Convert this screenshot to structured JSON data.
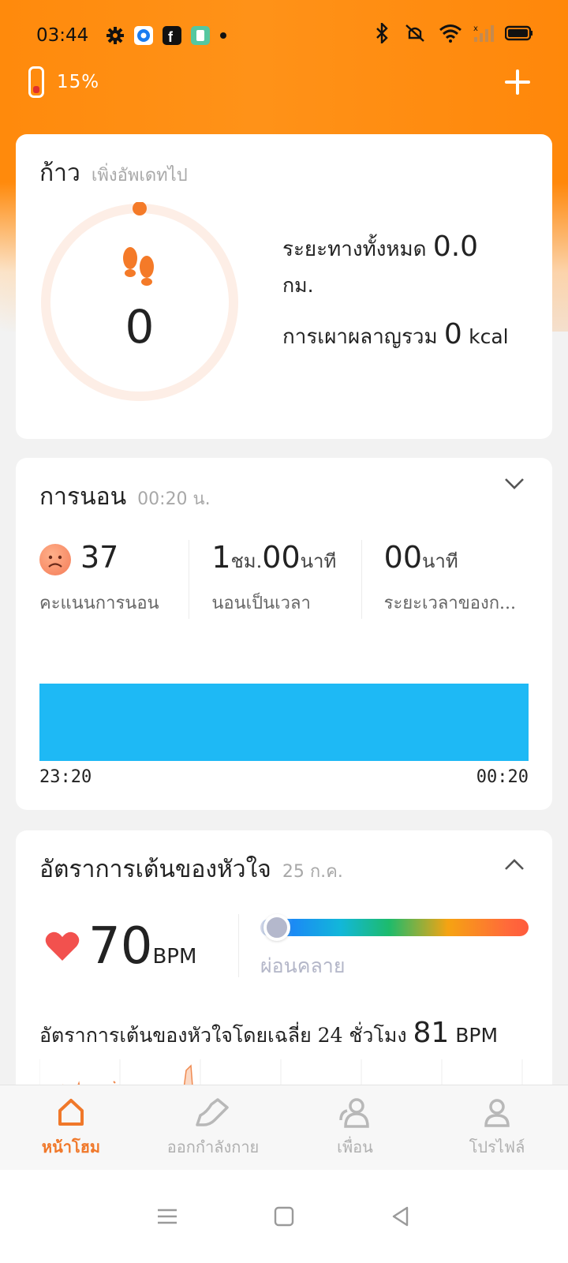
{
  "status_bar": {
    "time": "03:44",
    "icons": [
      "gear-icon",
      "app-icon",
      "facebook-icon",
      "app-icon",
      "dot-icon"
    ],
    "right_icons": [
      "bluetooth-icon",
      "mute-icon",
      "wifi-icon",
      "signal-icon",
      "battery-icon"
    ]
  },
  "device": {
    "battery_pct": "15%"
  },
  "steps": {
    "title": "ก้าว",
    "subtitle": "เพิ่งอัพเดทไป",
    "count": "0",
    "distance_label": "ระยะทางทั้งหมด",
    "distance_value": "0.0",
    "distance_unit": "กม.",
    "calories_label": "การเผาผลาญรวม",
    "calories_value": "0",
    "calories_unit": "kcal",
    "progress": 0
  },
  "sleep": {
    "title": "การนอน",
    "subtitle": "00:20 น.",
    "score_value": "37",
    "score_label": "คะแนนการนอน",
    "duration_hours": "1",
    "duration_h_unit": "ชม.",
    "duration_minutes": "00",
    "duration_m_unit": "นาที",
    "duration_label": "นอนเป็นเวลา",
    "period_minutes": "00",
    "period_unit": "นาที",
    "period_label": "ระยะเวลาของก...",
    "start_time": "23:20",
    "end_time": "00:20",
    "bar_color": "#1eb9f5"
  },
  "heart": {
    "title": "อัตราการเต้นของหัวใจ",
    "subtitle": "25 ก.ค.",
    "bpm_value": "70",
    "bpm_unit": "BPM",
    "zone_label": "ผ่อนคลาย",
    "avg_label": "อัตราการเต้นของหัวใจโดยเฉลี่ย 24 ชั่วโมง",
    "avg_value": "81",
    "avg_unit": "BPM"
  },
  "nav": {
    "home": "หน้าโฮม",
    "workout": "ออกกำลังกาย",
    "friends": "เพื่อน",
    "profile": "โปรไฟล์"
  },
  "colors": {
    "accent": "#f0782a",
    "header": "#ff8a0c",
    "heart": "#f2514e"
  }
}
